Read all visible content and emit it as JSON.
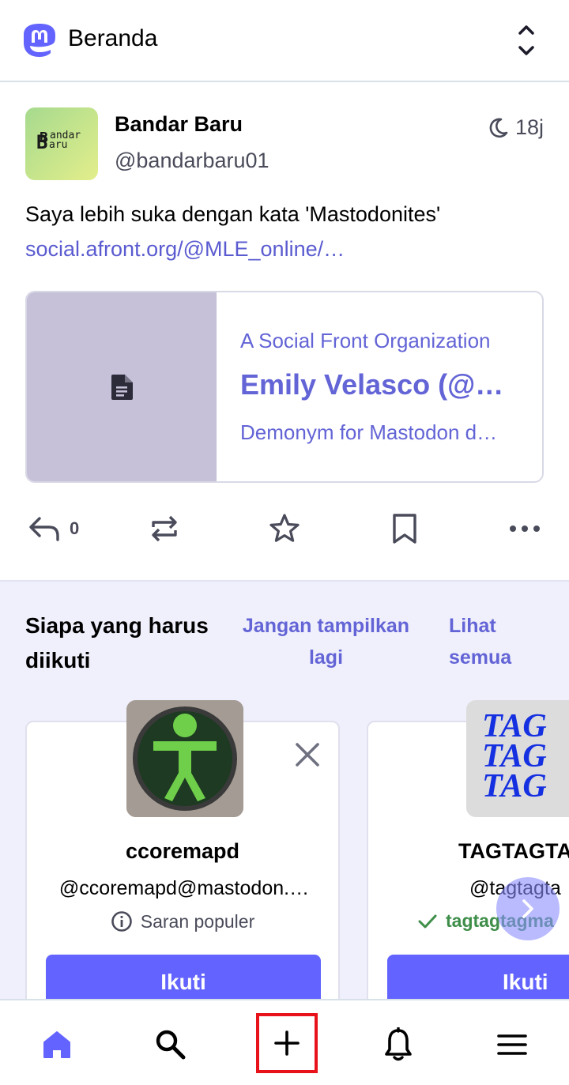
{
  "header": {
    "title": "Beranda",
    "logo_icon": "mastodon-logo",
    "scroll_toggle_icon": "chevron-up-down-icon"
  },
  "post": {
    "avatar_text": {
      "line1_big": "B",
      "line1_small": "andar",
      "line2_big": "B",
      "line2_small": "aru"
    },
    "display_name": "Bandar Baru",
    "handle": "@bandarbaru01",
    "time": "18j",
    "visibility_icon": "moon-icon",
    "text": "Saya lebih suka dengan kata 'Mastodonites'",
    "link": "social.afront.org/@MLE_online/…",
    "card": {
      "source": "A Social Front Organization",
      "title": "Emily Velasco (@…",
      "description": "Demonym for Mastodon d…",
      "thumb_icon": "document-icon"
    },
    "actions": {
      "reply_count": "0",
      "icons": [
        "reply-icon",
        "boost-icon",
        "star-icon",
        "bookmark-icon",
        "more-icon"
      ]
    }
  },
  "suggestions": {
    "title": "Siapa yang harus diikuti",
    "dismiss_label": "Jangan tampilkan lagi",
    "see_all_label": "Lihat semua",
    "accounts": [
      {
        "name": "ccoremapd",
        "handle": "@ccoremapd@mastodon.…",
        "reason": "Saran populer",
        "reason_icon": "info-icon",
        "follow_label": "Ikuti"
      },
      {
        "name": "TAGTAGTA",
        "handle": "@tagtagta",
        "reason": "tagtagtagma",
        "reason_icon": "check-icon",
        "follow_label": "Ikuti",
        "avatar_text": "TAG"
      }
    ]
  },
  "bottom_nav": {
    "items": [
      "home-icon",
      "search-icon",
      "compose-icon",
      "notifications-icon",
      "menu-icon"
    ]
  },
  "colors": {
    "accent": "#6364ff",
    "link": "#5a5bd0",
    "verified": "#3e8e49",
    "highlight": "#e8121a"
  }
}
